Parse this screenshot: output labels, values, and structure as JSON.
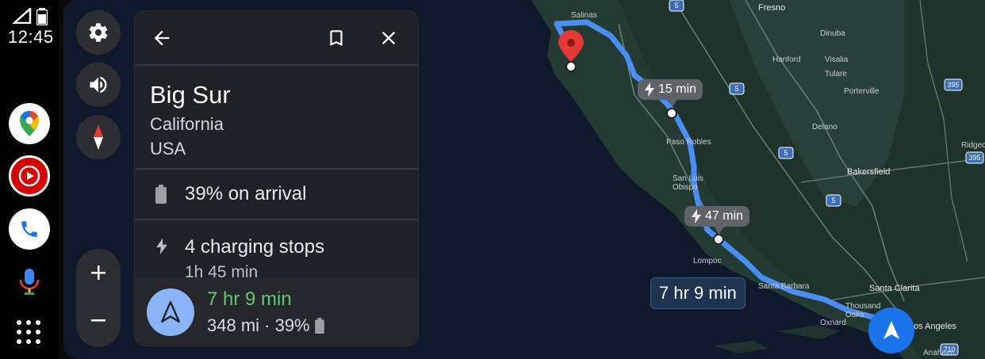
{
  "status": {
    "time": "12:45"
  },
  "rail": {
    "apps": [
      "google-maps",
      "youtube-music",
      "phone"
    ],
    "mic_icon": "microphone-icon",
    "launcher_icon": "app-grid-icon"
  },
  "map": {
    "callouts": [
      {
        "text": "15 min"
      },
      {
        "text": "47 min"
      }
    ],
    "route_time": "7 hr 9 min",
    "cities": [
      "Salinas",
      "Fresno",
      "Dinuba",
      "Hanford",
      "Visalia",
      "Tulare",
      "Porterville",
      "Delano",
      "Paso Robles",
      "San Luis Obispo",
      "Bakersfield",
      "Ridgecrest",
      "Lompoc",
      "Santa Barbara",
      "Santa Clarita",
      "Thousand Oaks",
      "Oxnard",
      "Los Angeles",
      "Anaheim"
    ],
    "highway_shields": [
      "5",
      "5",
      "5",
      "5",
      "395",
      "395",
      "710"
    ]
  },
  "panel": {
    "title": "Big Sur",
    "subtitle1": "California",
    "subtitle2": "USA",
    "battery_text": "39% on arrival",
    "charging_text": "4 charging stops",
    "charging_sub": "1h 45 min",
    "eta": "7 hr 9 min",
    "distance_battery": "348 mi · 39%"
  },
  "colors": {
    "route": "#4a8df3",
    "eta_green": "#5fc873",
    "pin_red": "#e53935",
    "fab_blue": "#1a73e8"
  }
}
